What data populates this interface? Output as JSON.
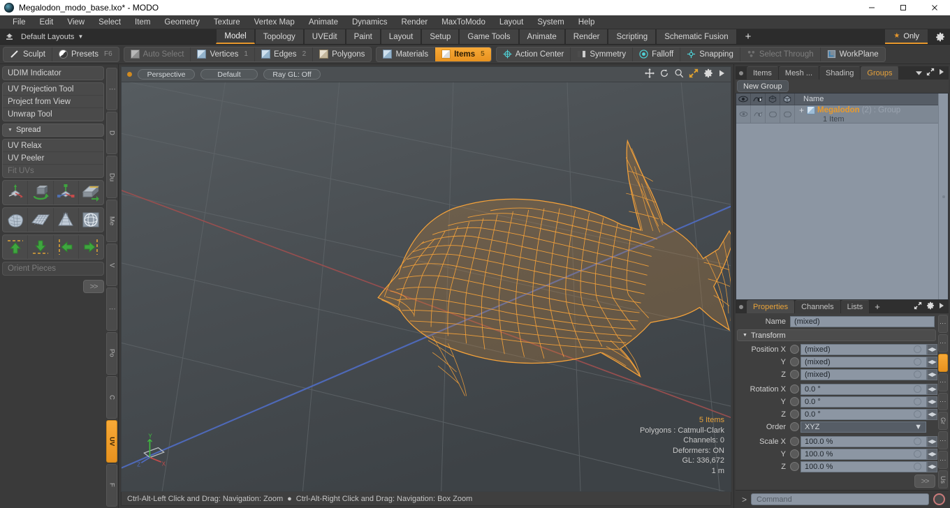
{
  "window": {
    "title": "Megalodon_modo_base.lxo* - MODO",
    "logo_icon": "modo-logo-icon",
    "minimize_label": "—",
    "maximize_label": "□",
    "close_label": "✕"
  },
  "menu": {
    "items": [
      "File",
      "Edit",
      "View",
      "Select",
      "Item",
      "Geometry",
      "Texture",
      "Vertex Map",
      "Animate",
      "Dynamics",
      "Render",
      "MaxToModo",
      "Layout",
      "System",
      "Help"
    ]
  },
  "layoutbar": {
    "home_icon": "home-up-icon",
    "dropdown_label": "Default Layouts",
    "caret_icon": "chevron-down-icon",
    "tabs": [
      {
        "label": "Model",
        "active": true
      },
      {
        "label": "Topology",
        "active": false
      },
      {
        "label": "UVEdit",
        "active": false
      },
      {
        "label": "Paint",
        "active": false
      },
      {
        "label": "Layout",
        "active": false
      },
      {
        "label": "Setup",
        "active": false
      },
      {
        "label": "Game Tools",
        "active": false
      },
      {
        "label": "Animate",
        "active": false
      },
      {
        "label": "Render",
        "active": false
      },
      {
        "label": "Scripting",
        "active": false
      },
      {
        "label": "Schematic Fusion",
        "active": false
      }
    ],
    "add_tab_label": "+",
    "only_label": "Only",
    "star_icon": "star-icon",
    "gear_icon": "gear-icon"
  },
  "toolbar": {
    "group1": [
      {
        "label": "Sculpt",
        "icon": "sculpt-pen-icon",
        "state": "normal",
        "num": ""
      },
      {
        "label": "Presets",
        "icon": "presets-sphere-icon",
        "state": "normal",
        "num": "F6"
      }
    ],
    "group2": [
      {
        "label": "Auto Select",
        "icon": "cube-gray-icon",
        "state": "dim",
        "num": ""
      },
      {
        "label": "Vertices",
        "icon": "cube-blue-icon",
        "state": "normal",
        "num": "1"
      },
      {
        "label": "Edges",
        "icon": "cube-blue-icon",
        "state": "normal",
        "num": "2"
      },
      {
        "label": "Polygons",
        "icon": "cube-tan-icon",
        "state": "normal",
        "num": ""
      }
    ],
    "group3": [
      {
        "label": "Materials",
        "icon": "cube-blue-icon",
        "state": "normal",
        "num": ""
      },
      {
        "label": "Items",
        "icon": "cube-orange-icon",
        "state": "selected",
        "num": "5"
      }
    ],
    "group4": [
      {
        "label": "Action Center",
        "icon": "action-center-icon",
        "state": "normal",
        "num": ""
      },
      {
        "label": "Symmetry",
        "icon": "symmetry-icon",
        "state": "normal",
        "num": ""
      },
      {
        "label": "Falloff",
        "icon": "falloff-icon",
        "state": "normal",
        "num": ""
      },
      {
        "label": "Snapping",
        "icon": "snapping-icon",
        "state": "normal",
        "num": ""
      },
      {
        "label": "Select Through",
        "icon": "select-through-icon",
        "state": "dim",
        "num": ""
      },
      {
        "label": "WorkPlane",
        "icon": "workplane-icon",
        "state": "normal",
        "num": ""
      }
    ]
  },
  "left_panel": {
    "group_a": [
      "UDIM Indicator"
    ],
    "group_b": [
      "UV Projection Tool",
      "Project from View",
      "Unwrap Tool"
    ],
    "section_spread": {
      "label": "Spread",
      "tri_icon": "triangle-down-icon"
    },
    "group_c": [
      {
        "label": "UV Relax",
        "dim": false
      },
      {
        "label": "UV Peeler",
        "dim": false
      },
      {
        "label": "Fit UVs",
        "dim": true
      }
    ],
    "icon_rows": [
      [
        "uv-move-gizmo-icon",
        "uv-rotate-gizmo-icon",
        "uv-scale-gizmo-icon",
        "uv-flip-icon"
      ],
      [
        "uv-drape-icon",
        "uv-grid-plane-icon",
        "uv-cone-icon",
        "uv-sphere-wrap-icon"
      ],
      [
        "align-up-icon",
        "align-down-icon",
        "align-left-icon",
        "align-right-icon"
      ]
    ],
    "orient_field": "Orient Pieces",
    "expand_label": ">>",
    "vertical_tabs": [
      {
        "label": "⋮",
        "active": false
      },
      {
        "label": "D",
        "active": false
      },
      {
        "label": "Du",
        "active": false
      },
      {
        "label": "Me",
        "active": false
      },
      {
        "label": "V",
        "active": false
      },
      {
        "label": "⋮",
        "active": false
      },
      {
        "label": "Po",
        "active": false
      },
      {
        "label": "C",
        "active": false
      },
      {
        "label": "UV",
        "active": true
      },
      {
        "label": "F",
        "active": false
      }
    ]
  },
  "viewport": {
    "header": {
      "pills": [
        "Perspective",
        "Default",
        "Ray GL: Off"
      ],
      "icons": [
        "move-icon",
        "rotate-icon",
        "zoom-magnifier-icon",
        "expand-icon",
        "gear-icon",
        "play-arrow-icon"
      ]
    },
    "stats": {
      "items_count": "5 Items",
      "polygons": "Polygons : Catmull-Clark",
      "channels": "Channels: 0",
      "deformers": "Deformers: ON",
      "gl": "GL: 336,672",
      "scale": "1 m"
    },
    "axis_gizmo": {
      "x": "X",
      "y": "Y",
      "z": "Z"
    },
    "model_name": "megalodon-shark-wireframe",
    "wire_color": "#f5a23a"
  },
  "statusbar": {
    "left_hint": "Ctrl-Alt-Left Click and Drag: Navigation: Zoom",
    "separator": "●",
    "right_hint": "Ctrl-Alt-Right Click and Drag: Navigation: Box Zoom"
  },
  "right_panel": {
    "top_tabs": [
      {
        "label": "Items",
        "active": false
      },
      {
        "label": "Mesh ...",
        "active": false
      },
      {
        "label": "Shading",
        "active": false
      },
      {
        "label": "Groups",
        "active": true
      }
    ],
    "top_tab_add": "",
    "top_icons": [
      "chevron-down-icon",
      "expand-arrows-icon",
      "play-arrow-icon"
    ],
    "new_group_button": "New Group",
    "tree": {
      "columns": [
        "eye-icon",
        "render-icon",
        "cube-outline-icon",
        "cube-solid-icon"
      ],
      "name_header": "Name",
      "rows": [
        {
          "expand_icon": "plus-icon",
          "item_icon": "group-cube-icon",
          "name": "Megalodon",
          "count": "(2)",
          "type": ": Group",
          "subtitle": "1 Item"
        }
      ]
    },
    "properties": {
      "tabs": [
        {
          "label": "Properties",
          "active": true
        },
        {
          "label": "Channels",
          "active": false
        },
        {
          "label": "Lists",
          "active": false
        }
      ],
      "tab_add": "+",
      "icons": [
        "expand-arrows-icon",
        "gear-icon",
        "play-arrow-icon"
      ],
      "name_label": "Name",
      "name_value": "(mixed)",
      "transform_label": "Transform",
      "fields": [
        {
          "label": "Position X",
          "value": "(mixed)",
          "type": "num"
        },
        {
          "label": "Y",
          "value": "(mixed)",
          "type": "num"
        },
        {
          "label": "Z",
          "value": "(mixed)",
          "type": "num"
        },
        {
          "label": "Rotation X",
          "value": "0.0 °",
          "type": "num"
        },
        {
          "label": "Y",
          "value": "0.0 °",
          "type": "num"
        },
        {
          "label": "Z",
          "value": "0.0 °",
          "type": "num"
        },
        {
          "label": "Order",
          "value": "XYZ",
          "type": "dropdown"
        },
        {
          "label": "Scale X",
          "value": "100.0 %",
          "type": "num"
        },
        {
          "label": "Y",
          "value": "100.0 %",
          "type": "num"
        },
        {
          "label": "Z",
          "value": "100.0 %",
          "type": "num"
        }
      ],
      "expand_label": ">>",
      "vertical_tabs": [
        {
          "label": "⋮",
          "active": false
        },
        {
          "label": "⋮",
          "active": false
        },
        {
          "label": "",
          "active": true
        },
        {
          "label": "⋮",
          "active": false
        },
        {
          "label": "⋮",
          "active": false
        },
        {
          "label": "Gr",
          "active": false
        },
        {
          "label": "⋮",
          "active": false
        },
        {
          "label": "⋮",
          "active": false
        },
        {
          "label": "Us",
          "active": false
        }
      ]
    }
  },
  "command_bar": {
    "prompt": "&gt;",
    "placeholder": "Command",
    "record_icon": "record-circle-icon"
  }
}
